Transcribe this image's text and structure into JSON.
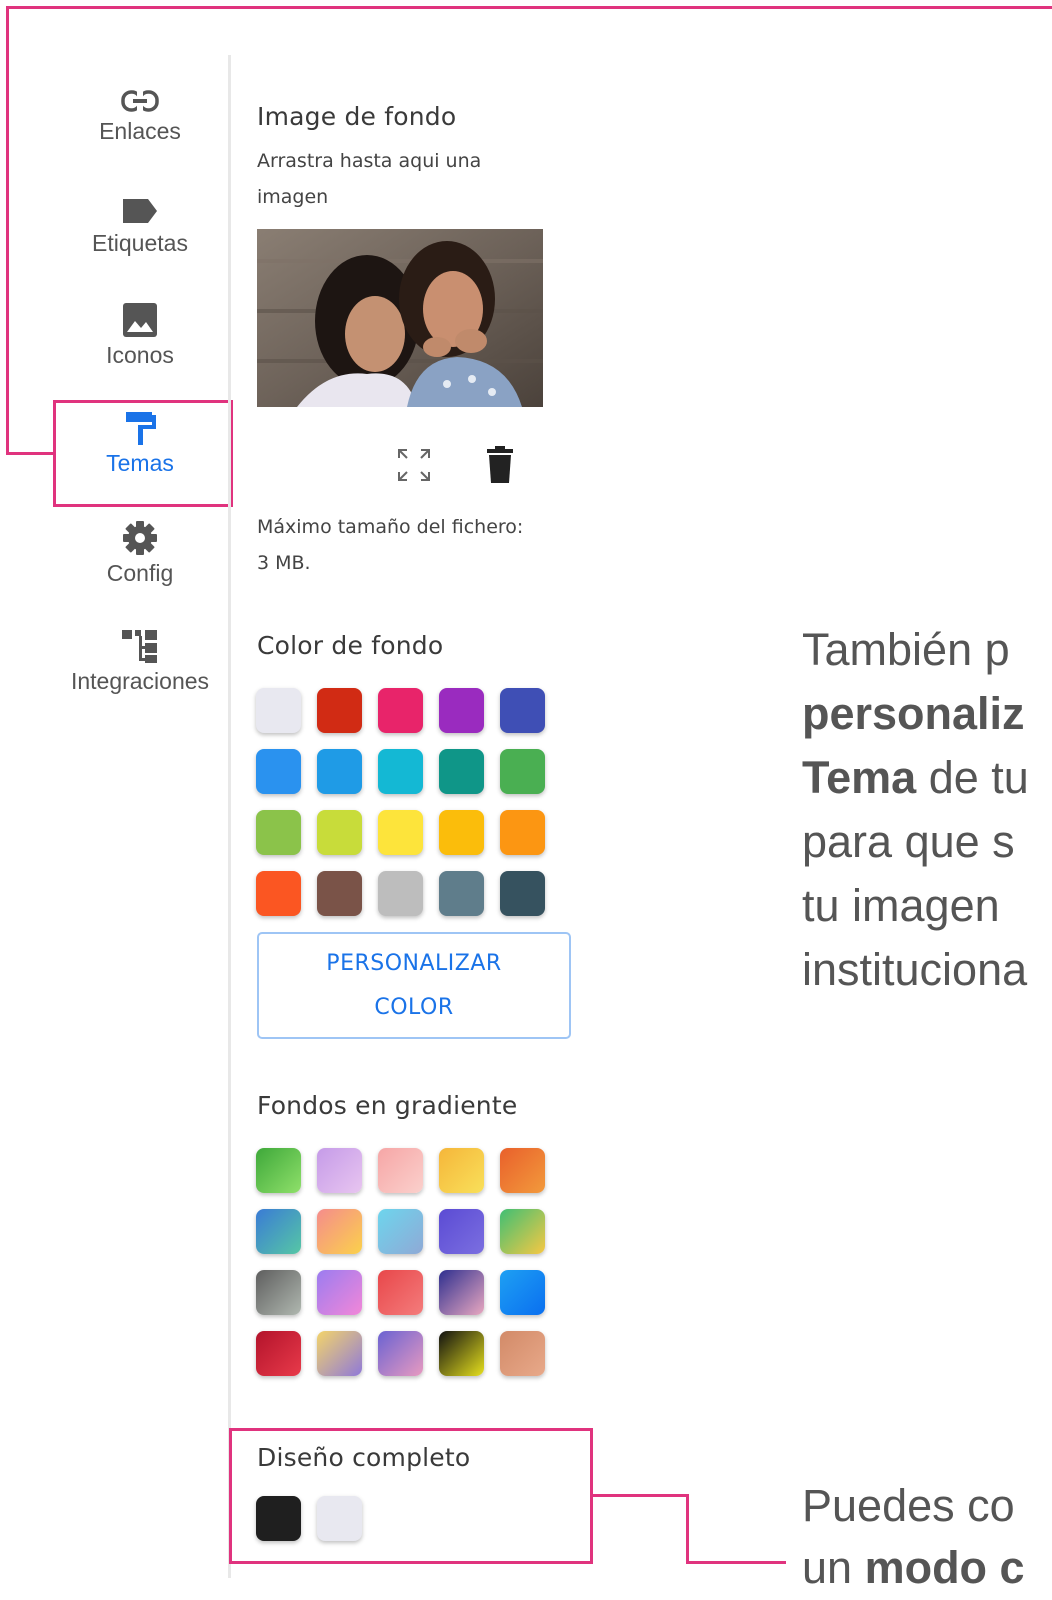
{
  "sidebar": {
    "items": [
      {
        "label": "Enlaces",
        "icon": "link-icon"
      },
      {
        "label": "Etiquetas",
        "icon": "label-icon"
      },
      {
        "label": "Iconos",
        "icon": "image-icon"
      },
      {
        "label": "Temas",
        "icon": "paint-roller-icon",
        "active": true
      },
      {
        "label": "Config",
        "icon": "gear-icon"
      },
      {
        "label": "Integraciones",
        "icon": "hierarchy-icon"
      }
    ]
  },
  "background_image": {
    "title": "Image de fondo",
    "hint_line1": "Arrastra hasta aqui una",
    "hint_line2": "imagen",
    "max_size_line1": "Máximo tamaño del fichero:",
    "max_size_line2": "3 MB."
  },
  "background_color": {
    "title": "Color de fondo",
    "swatches": [
      "#e8e8f0",
      "#d12b14",
      "#e8246a",
      "#9a2bbf",
      "#3f4fb5",
      "#2a92ef",
      "#1f9be6",
      "#14b8d4",
      "#0f9688",
      "#4aaf52",
      "#8bc34a",
      "#c8dc3a",
      "#fde43b",
      "#fbbd0b",
      "#fc9612",
      "#fb5622",
      "#7a5348",
      "#bdbdbd",
      "#5f7d8b",
      "#36525f"
    ],
    "custom_button_line1": "PERSONALIZAR",
    "custom_button_line2": "COLOR"
  },
  "gradient_backgrounds": {
    "title": "Fondos en gradiente",
    "swatches": [
      [
        "#3ea83a",
        "#8fe06a"
      ],
      [
        "#c59be8",
        "#e8c5f0"
      ],
      [
        "#f6a6a6",
        "#fbd0cc"
      ],
      [
        "#f5b63a",
        "#f9e05a"
      ],
      [
        "#e9602b",
        "#f29a3c"
      ],
      [
        "#3a7bd5",
        "#56c7a5"
      ],
      [
        "#f58c8c",
        "#fbd14b"
      ],
      [
        "#6dd5ed",
        "#8fa9d6"
      ],
      [
        "#5b4bd4",
        "#7b6fe0"
      ],
      [
        "#3fbf74",
        "#f7c843"
      ],
      [
        "#5e5e5e",
        "#b0b8b0"
      ],
      [
        "#9b7cf0",
        "#f287d8"
      ],
      [
        "#e8474a",
        "#f47c7c"
      ],
      [
        "#2e2f8f",
        "#e9a8c0"
      ],
      [
        "#1ea0f3",
        "#0a6ff0"
      ],
      [
        "#b3132b",
        "#e83a4a"
      ],
      [
        "#f3d46a",
        "#8f79d9"
      ],
      [
        "#6a62d2",
        "#e89ac0"
      ],
      [
        "#111111",
        "#e6e01e"
      ],
      [
        "#d28a68",
        "#e8a98a"
      ]
    ]
  },
  "full_design": {
    "title": "Diseño completo",
    "swatches": [
      "#1f1f1f",
      "#e8e8f0"
    ]
  },
  "annotations": {
    "note1_line1": "También p",
    "note1_line2": "personaliz",
    "note1_line3_bold": "Tema",
    "note1_line3_rest": " de tu",
    "note1_line4": "para que s",
    "note1_line5": "tu imagen",
    "note1_line6": "instituciona",
    "note2_line1": "Puedes co",
    "note2_line2_start": "un ",
    "note2_line2_bold": "modo c"
  },
  "colors": {
    "accent": "#1a73e8",
    "annotation": "#e0337e"
  }
}
